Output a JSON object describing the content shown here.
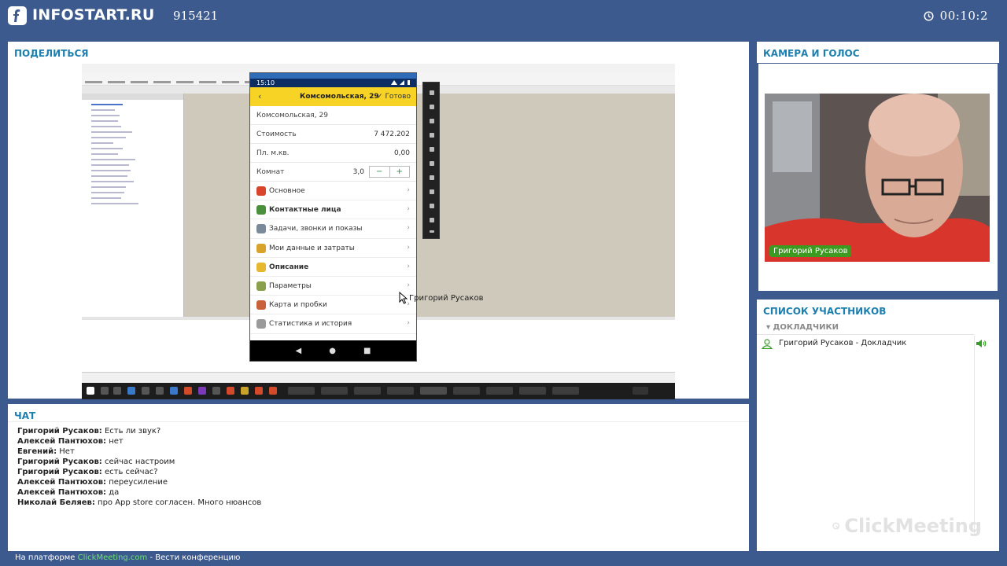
{
  "header": {
    "logo": "INFOSTART.RU",
    "room_id": "915421",
    "timer": "00:10:2"
  },
  "share": {
    "title": "ПОДЕЛИТЬСЯ",
    "phone": {
      "time": "15:10",
      "appbar_title": "Комсомольская, 29",
      "done_label": "Готово",
      "address": "Комсомольская, 29",
      "fields": [
        {
          "label": "Стоимость",
          "value": "7 472.202"
        },
        {
          "label": "Пл. м.кв.",
          "value": "0,00"
        }
      ],
      "rooms_label": "Комнат",
      "rooms_value": "3,0",
      "menu": [
        {
          "label": "Основное",
          "color": "#d9452b"
        },
        {
          "label": "Контактные лица",
          "color": "#4a8f3a"
        },
        {
          "label": "Задачи, звонки и показы",
          "color": "#7a8a9a"
        },
        {
          "label": "Мои данные и затраты",
          "color": "#d8a32b"
        },
        {
          "label": "Описание",
          "color": "#e6b830"
        },
        {
          "label": "Параметры",
          "color": "#8aa04a"
        },
        {
          "label": "Карта и пробки",
          "color": "#c9623a"
        },
        {
          "label": "Статистика и история",
          "color": "#9a9a9a"
        }
      ]
    },
    "cursor_label": "Григорий Русаков"
  },
  "camera": {
    "title": "КАМЕРА И ГОЛОС",
    "speaker_name": "Григорий Русаков"
  },
  "participants": {
    "title": "СПИСОК УЧАСТНИКОВ",
    "group": "ДОКЛАДЧИКИ",
    "items": [
      {
        "name": "Григорий Русаков  - Докладчик"
      }
    ],
    "watermark": "ClickMeeting"
  },
  "chat": {
    "title": "ЧАТ",
    "messages": [
      {
        "author": "Григорий Русаков:",
        "text": " Есть ли звук?"
      },
      {
        "author": "Алексей Пантюхов:",
        "text": " нет"
      },
      {
        "author": "Евгений:",
        "text": " Нет"
      },
      {
        "author": "Григорий Русаков:",
        "text": " сейчас настроим"
      },
      {
        "author": "Григорий Русаков:",
        "text": " есть сейчас?"
      },
      {
        "author": "Алексей Пантюхов:",
        "text": " переусиление"
      },
      {
        "author": "Алексей Пантюхов:",
        "text": " да"
      },
      {
        "author": "Николай Беляев:",
        "text": " про App store согласен. Много нюансов"
      }
    ]
  },
  "footer": {
    "prefix": "На платформе ",
    "link": "ClickMeeting.com",
    "suffix": " - Вести конференцию"
  }
}
